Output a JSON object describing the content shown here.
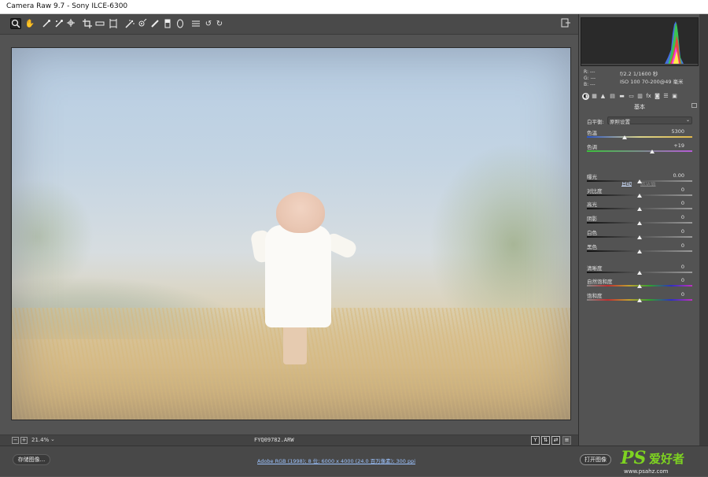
{
  "window": {
    "title": "Camera Raw 9.7  -  Sony ILCE-6300"
  },
  "toolbar": {
    "tools": [
      "zoom-icon",
      "hand-icon",
      "white-balance-icon",
      "color-sampler-icon",
      "targeted-adjust-icon",
      "crop-icon",
      "straighten-icon",
      "transform-icon",
      "spot-removal-icon",
      "red-eye-icon",
      "adjustment-brush-icon",
      "graduated-filter-icon",
      "radial-filter-icon",
      "preferences-icon",
      "rotate-left-icon",
      "rotate-right-icon"
    ],
    "glyphs": [
      "🔍",
      "✋",
      "✎",
      "✎",
      "◎",
      "⌗",
      "▭",
      "⊞",
      "✦",
      "◉",
      "✐",
      "▯",
      "◯",
      "☰",
      "↺",
      "↻"
    ]
  },
  "status": {
    "zoom_value": "21.4%",
    "filename": "FYQ09782.ARW"
  },
  "metadata": {
    "r": "R: ---",
    "g": "G: ---",
    "b": "B: ---",
    "line1": "f/2.2  1/1600 秒",
    "line2": "ISO 100  70-200@49 毫米"
  },
  "panel": {
    "section_title": "基本",
    "wb_label": "白平衡:",
    "wb_value": "原照设置",
    "auto": "自动",
    "default": "默认值",
    "sliders": [
      {
        "label": "色温",
        "value": "5300",
        "pos": 0.36
      },
      {
        "label": "色调",
        "value": "+19",
        "pos": 0.62
      },
      {
        "label": "曝光",
        "value": "0.00",
        "pos": 0.5
      },
      {
        "label": "对比度",
        "value": "0",
        "pos": 0.5
      },
      {
        "label": "高光",
        "value": "0",
        "pos": 0.5
      },
      {
        "label": "阴影",
        "value": "0",
        "pos": 0.5
      },
      {
        "label": "白色",
        "value": "0",
        "pos": 0.5
      },
      {
        "label": "黑色",
        "value": "0",
        "pos": 0.5
      },
      {
        "label": "清晰度",
        "value": "0",
        "pos": 0.5
      },
      {
        "label": "自然饱和度",
        "value": "0",
        "pos": 0.5
      },
      {
        "label": "饱和度",
        "value": "0",
        "pos": 0.5
      }
    ]
  },
  "bottom": {
    "save_label": "存储图像...",
    "workflow": "Adobe RGB (1998); 8 位; 6000 x 4000 (24.0 百万像素); 300 ppi",
    "open_label": "打开图像"
  },
  "watermark": {
    "ps": "PS",
    "cn": "爱好者",
    "url": "www.psahz.com"
  },
  "colors": {
    "accent_link": "#9cc3ff",
    "brand_green": "#7ed321"
  }
}
